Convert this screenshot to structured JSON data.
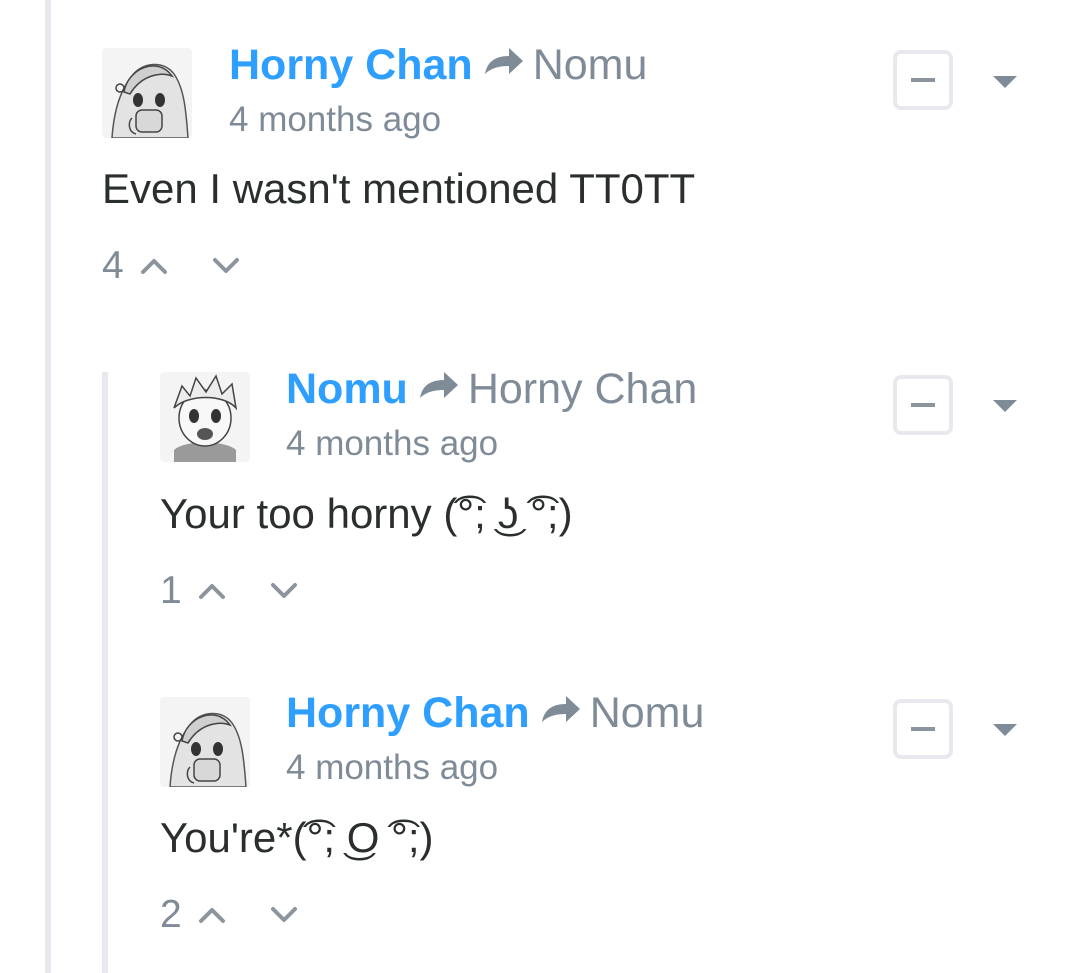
{
  "comments": [
    {
      "author": "Horny Chan",
      "reply_to": "Nomu",
      "time": "4 months ago",
      "text": "Even I wasn't mentioned TT0TT",
      "votes": "4",
      "avatar_icon": "manga-girl-avatar"
    },
    {
      "author": "Nomu",
      "reply_to": "Horny Chan",
      "time": "4 months ago",
      "text": "Your too horny (͡°; ͜ʖ ͡°;)",
      "votes": "1",
      "avatar_icon": "manga-boy-avatar"
    },
    {
      "author": "Horny Chan",
      "reply_to": "Nomu",
      "time": "4 months ago",
      "text": "You're*(͡°; ͜O ͡°;)",
      "votes": "2",
      "avatar_icon": "manga-girl-avatar"
    }
  ],
  "icons": {
    "reply_arrow": "reply-arrow-icon",
    "upvote": "upvote-chevron-icon",
    "downvote": "downvote-chevron-icon",
    "collapse": "collapse-minus-icon",
    "menu": "dropdown-caret-icon"
  },
  "colors": {
    "author": "#2e9fff",
    "muted": "#7f8b97",
    "text": "#2a2e2e",
    "thread_line": "#e7e9ee"
  }
}
